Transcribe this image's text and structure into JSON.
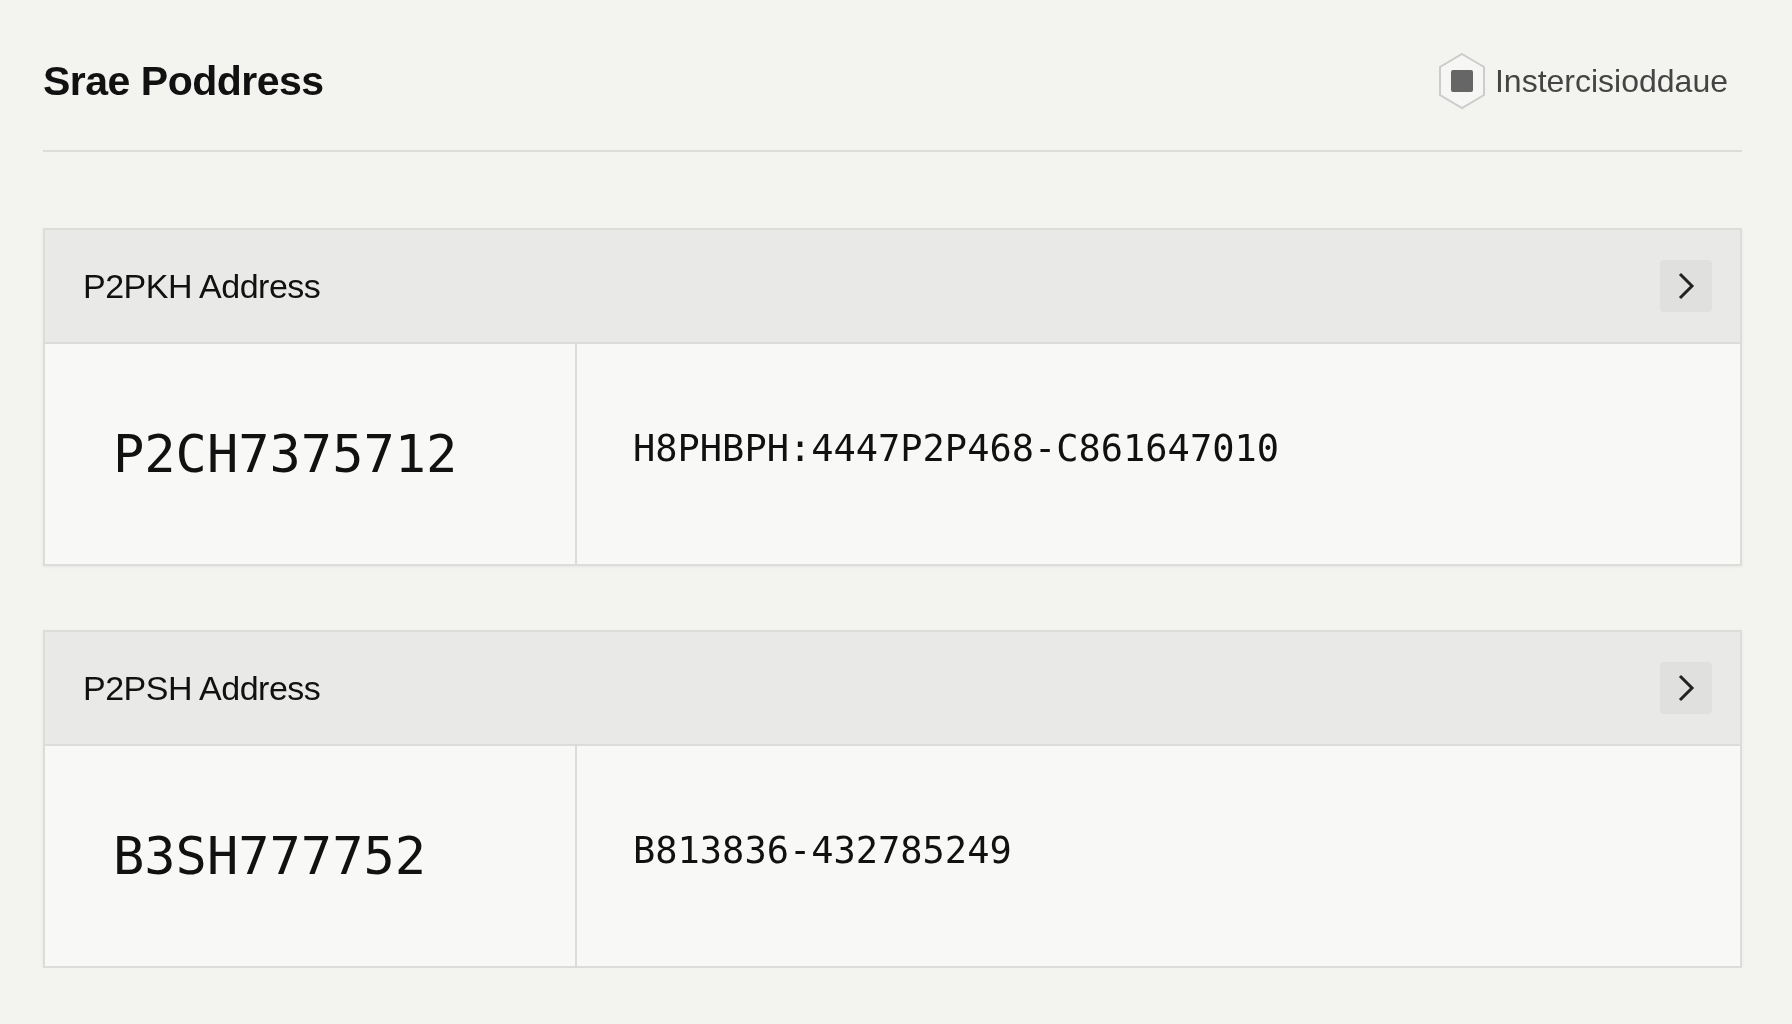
{
  "header": {
    "title": "Srae Poddress",
    "badge": "Instercisioddaue"
  },
  "cards": [
    {
      "title": "P2PKH Address",
      "code": "P2CH7375712",
      "value": "H8PHBPH:4447P2P468-C861647010"
    },
    {
      "title": "P2PSH Address",
      "code": "B3SH777752",
      "value": "B813836-432785249"
    }
  ]
}
